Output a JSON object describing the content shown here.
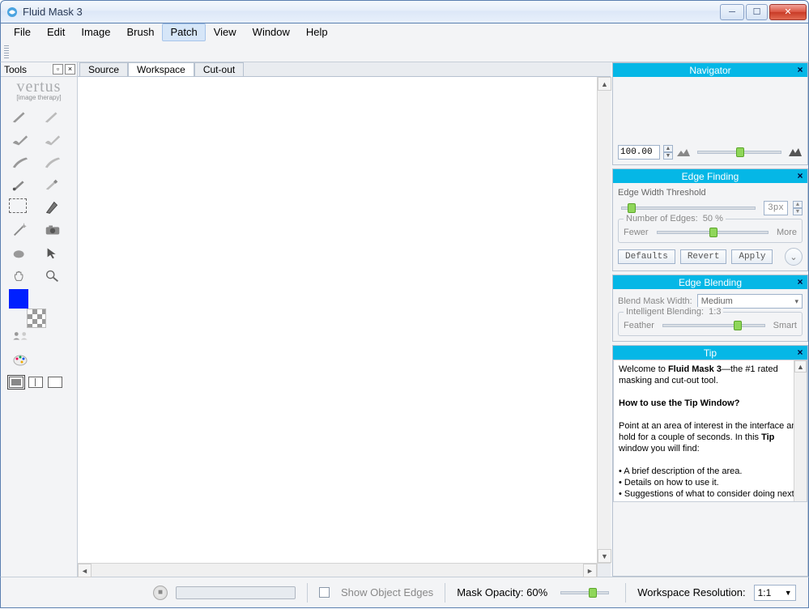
{
  "window": {
    "title": "Fluid Mask 3"
  },
  "menu": {
    "items": [
      "File",
      "Edit",
      "Image",
      "Brush",
      "Patch",
      "View",
      "Window",
      "Help"
    ],
    "highlighted": 4
  },
  "tools_panel": {
    "title": "Tools",
    "brand": "vertus",
    "brand_sub": "[image therapy]",
    "icons": [
      "brush1",
      "brush2",
      "wave-brush1",
      "wave-brush2",
      "feather-brush1",
      "feather-brush2",
      "fill-brush",
      "eraser-brush",
      "marquee",
      "pen",
      "wand",
      "camera",
      "blob",
      "arrow",
      "hand",
      "zoom"
    ],
    "swatches": {
      "primary": "#0020ff"
    },
    "extras": [
      "people-swap",
      "color-picker"
    ],
    "view_modes": [
      "single",
      "split",
      "quad"
    ]
  },
  "view_tabs": {
    "items": [
      "Source",
      "Workspace",
      "Cut-out"
    ],
    "active": 1
  },
  "navigator": {
    "title": "Navigator",
    "zoom_value": "100.00"
  },
  "edge_finding": {
    "title": "Edge Finding",
    "width_label": "Edge Width Threshold",
    "width_px": "3px",
    "edges_label": "Number of Edges:",
    "edges_pct": "50 %",
    "fewer": "Fewer",
    "more": "More",
    "defaults": "Defaults",
    "revert": "Revert",
    "apply": "Apply"
  },
  "edge_blending": {
    "title": "Edge Blending",
    "mask_width_label": "Blend Mask Width:",
    "mask_width_value": "Medium",
    "intel_label": "Intelligent Blending:",
    "intel_ratio": "1:3",
    "feather": "Feather",
    "smart": "Smart"
  },
  "tip": {
    "title": "Tip",
    "welcome_pre": "Welcome to ",
    "welcome_bold": "Fluid Mask 3",
    "welcome_post": "—the #1 rated masking and cut-out tool.",
    "how": "How to use the Tip Window?",
    "body1": "Point at an area of interest in the interface and hold for a couple of seconds. In this ",
    "body1_bold": "Tip",
    "body1_post": " window you will find:",
    "bul1": "• A brief description of the area.",
    "bul2": "• Details on how to use it.",
    "bul3": "• Suggestions of what to consider doing next."
  },
  "statusbar": {
    "show_edges": "Show Object Edges",
    "mask_opacity": "Mask Opacity: 60%",
    "res_label": "Workspace Resolution:",
    "res_value": "1:1"
  }
}
